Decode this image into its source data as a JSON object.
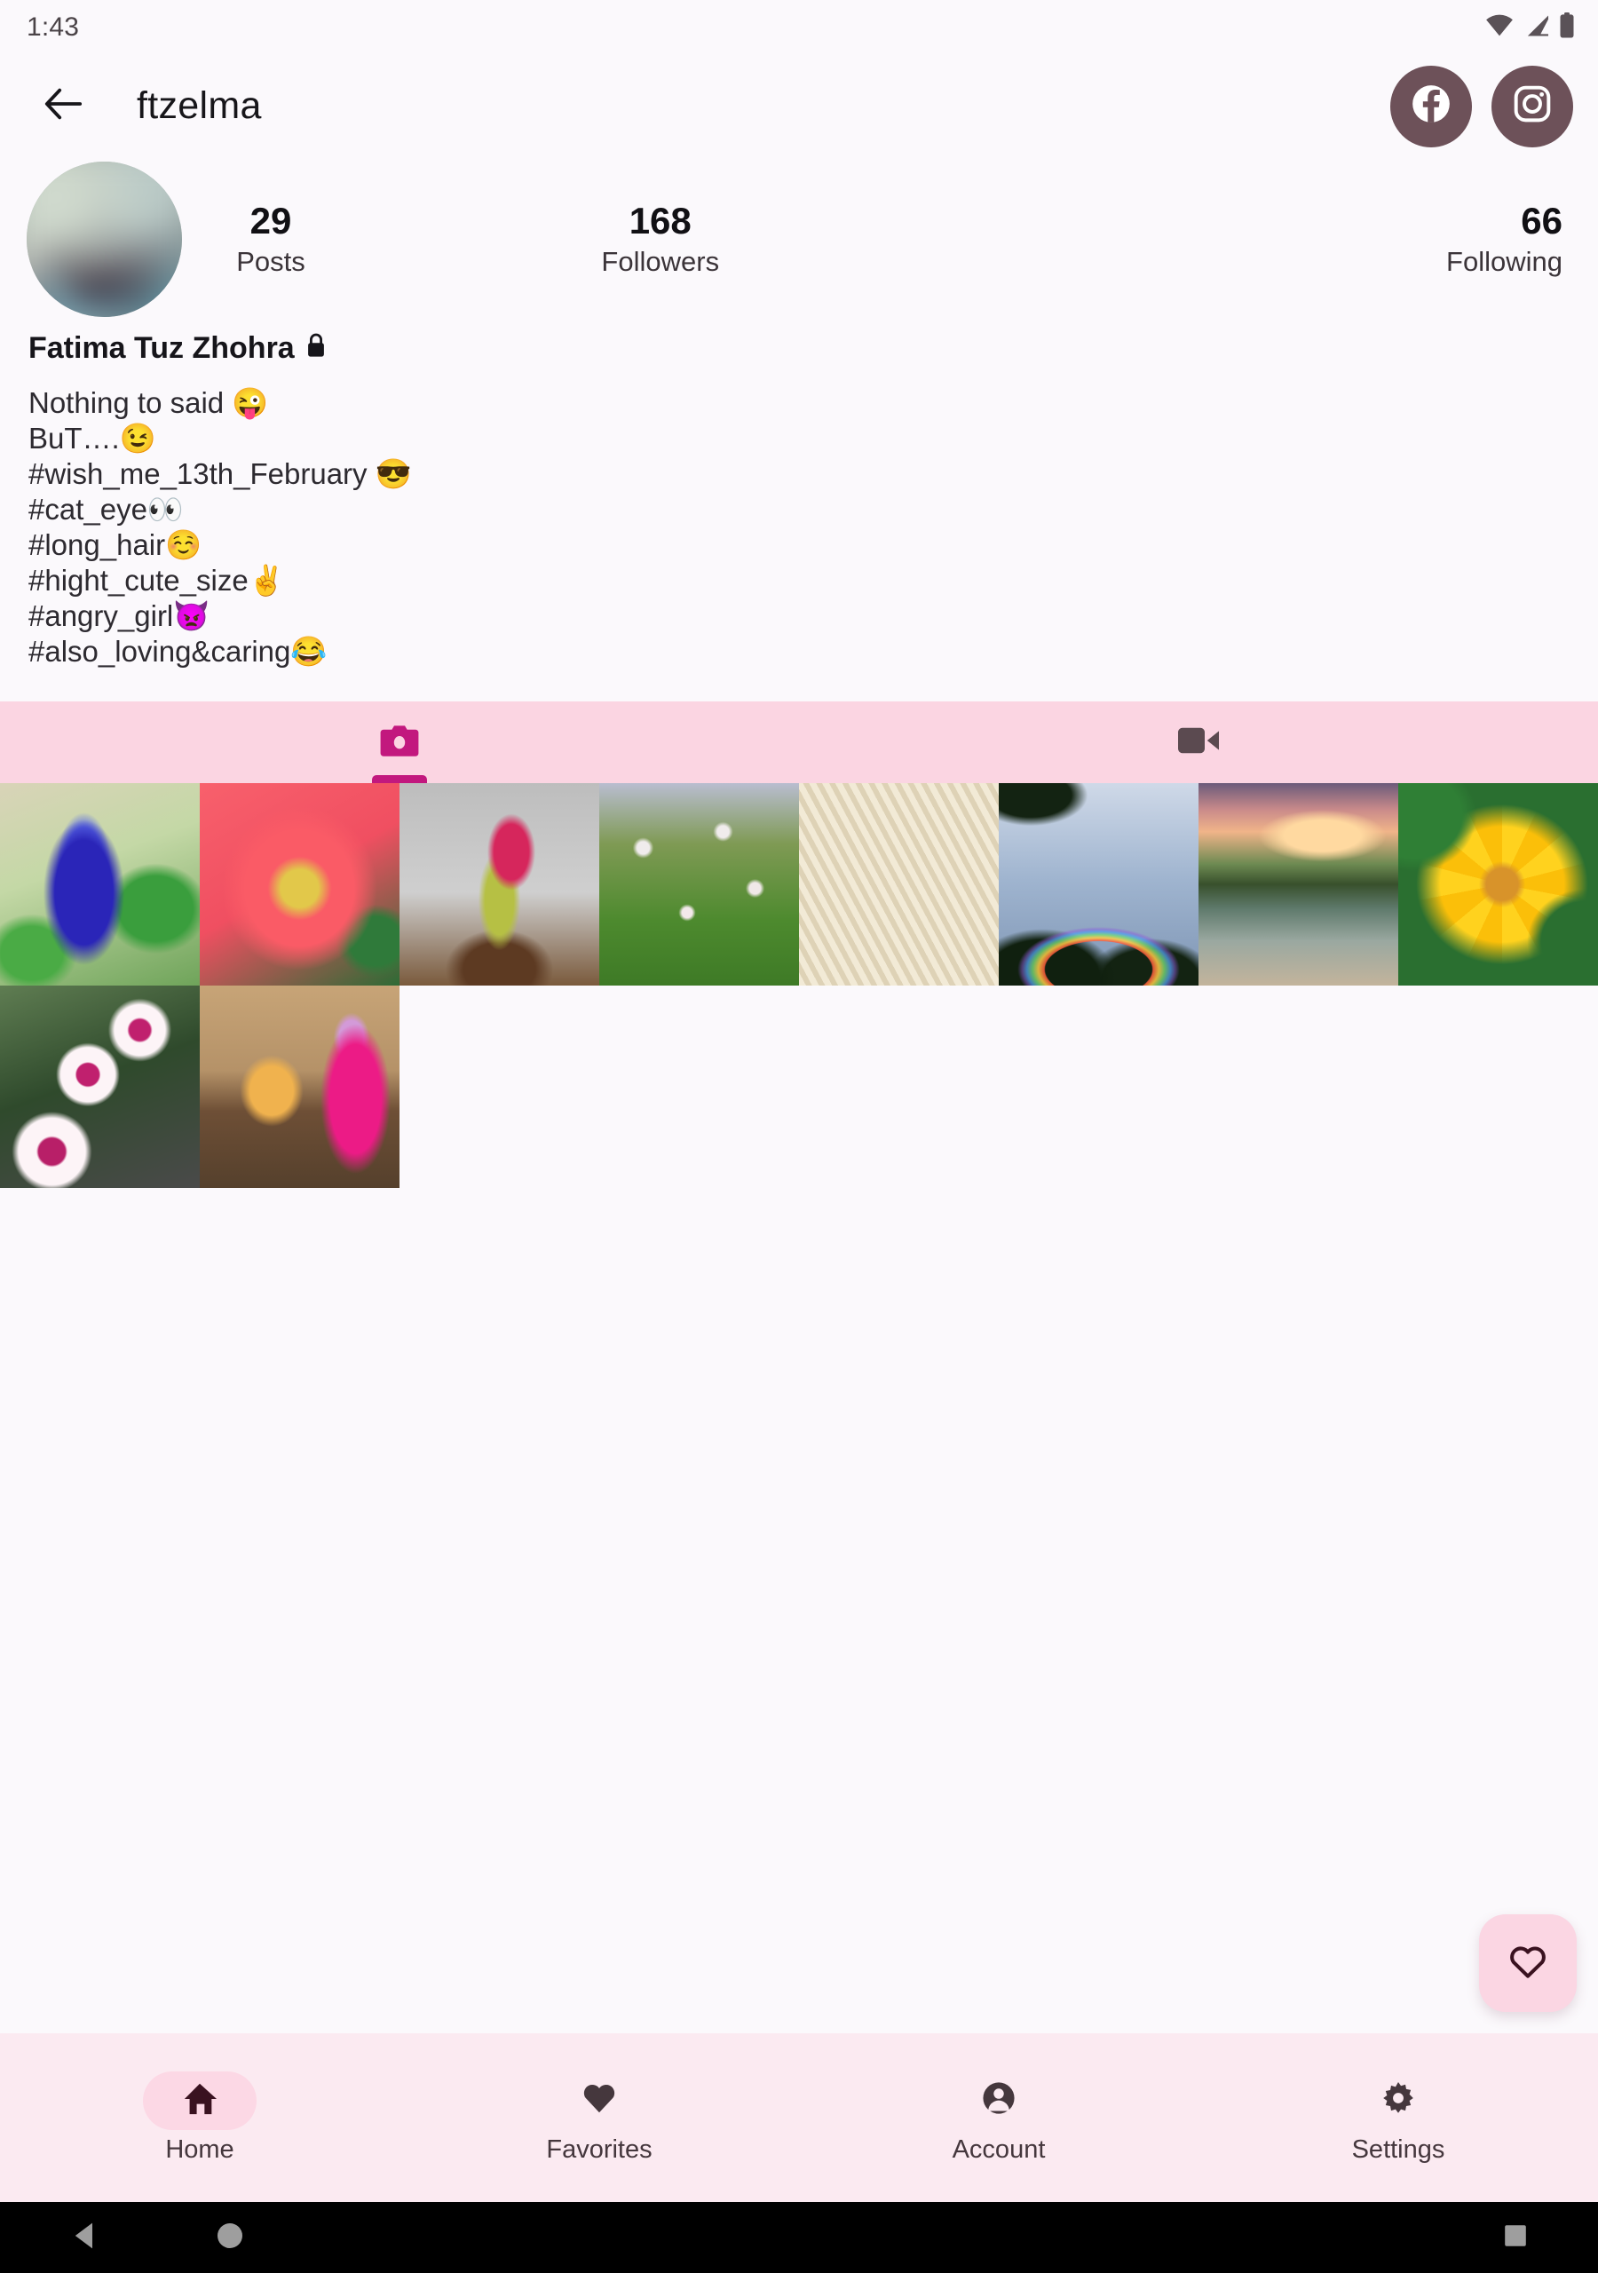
{
  "statusbar": {
    "time": "1:43",
    "icons": [
      "wifi-icon",
      "cellular-signal-icon",
      "battery-icon"
    ]
  },
  "appbar": {
    "back_icon": "back-arrow-icon",
    "title": "ftzelma",
    "social": [
      {
        "name": "facebook-icon",
        "label": "Facebook"
      },
      {
        "name": "instagram-icon",
        "label": "Instagram"
      }
    ]
  },
  "profile": {
    "avatar_alt": "profile-photo",
    "stats": [
      {
        "value": "29",
        "label": "Posts"
      },
      {
        "value": "168",
        "label": "Followers"
      },
      {
        "value": "66",
        "label": "Following"
      }
    ],
    "display_name": "Fatima Tuz Zhohra",
    "private_icon": "lock-icon",
    "bio_lines": [
      "Nothing to said 😜",
      "BuT….😉",
      "#wish_me_13th_February 😎",
      "#cat_eye👀",
      "#long_hair☺️",
      "#hight_cute_size✌️",
      "#angry_girl👿",
      "#also_loving&caring😂"
    ]
  },
  "media_tabs": [
    {
      "icon": "camera-icon",
      "label": "Photos",
      "active": true
    },
    {
      "icon": "video-camera-icon",
      "label": "Videos",
      "active": false
    }
  ],
  "grid": {
    "items": [
      {
        "art": "t-blueflower",
        "alt": "blue-butterfly-pea-flower"
      },
      {
        "art": "t-redflower",
        "alt": "red-hibiscus-flower"
      },
      {
        "art": "t-bud",
        "alt": "pink-flower-bud"
      },
      {
        "art": "t-meadow",
        "alt": "green-meadow-white-flowers"
      },
      {
        "art": "t-noodles",
        "alt": "white-shredded-food"
      },
      {
        "art": "t-rainbow",
        "alt": "rainbow-over-trees"
      },
      {
        "art": "t-sunset",
        "alt": "sunset-river-with-boat"
      },
      {
        "art": "t-yellowdaisy",
        "alt": "yellow-daisy-flower"
      },
      {
        "art": "t-dianthus",
        "alt": "pink-white-dianthus-flowers"
      },
      {
        "art": "t-kids",
        "alt": "child-with-cartoon-cutouts"
      }
    ]
  },
  "fab": {
    "icon": "heart-outline-icon",
    "label": "Like"
  },
  "bottom_nav": [
    {
      "icon": "home-icon",
      "label": "Home",
      "active": true
    },
    {
      "icon": "heart-icon",
      "label": "Favorites",
      "active": false
    },
    {
      "icon": "account-icon",
      "label": "Account",
      "active": false
    },
    {
      "icon": "settings-icon",
      "label": "Settings",
      "active": false
    }
  ],
  "system_nav": [
    {
      "icon": "system-back-icon"
    },
    {
      "icon": "system-home-icon"
    },
    {
      "icon": "system-recents-icon"
    }
  ],
  "colors": {
    "page_bg": "#fbf9fc",
    "tab_bar_pink": "#fbd5e2",
    "accent_magenta": "#c2187e",
    "social_button": "#6d5159",
    "bottom_nav_bg": "#fbeaf1",
    "active_pill": "#fcd8e5",
    "icon_dark": "#45373d"
  }
}
